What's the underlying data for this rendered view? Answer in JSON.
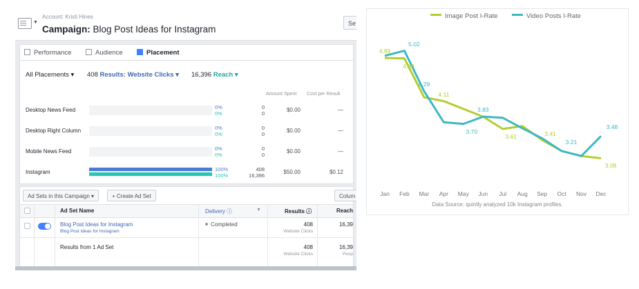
{
  "header": {
    "account": "Account: Kristi Hines",
    "campaign_prefix": "Campaign:",
    "campaign_name": "Blog Post Ideas for Instagram",
    "right_button": "Se"
  },
  "tabs": [
    {
      "label": "Performance",
      "icon": "performance-icon"
    },
    {
      "label": "Audience",
      "icon": "audience-icon"
    },
    {
      "label": "Placement",
      "icon": "placement-icon",
      "active": true
    }
  ],
  "filters": {
    "placements": "All Placements ▾",
    "results_count": "408",
    "results_label": "Results: Website Clicks ▾",
    "reach_count": "16,396",
    "reach_label": "Reach ▾"
  },
  "placement_columns": {
    "amount_spent": "Amount Spent",
    "cost_per_result": "Cost per Result"
  },
  "placement_rows": [
    {
      "name": "Desktop News Feed",
      "pct_results": "0%",
      "pct_reach": "0%",
      "results": "0",
      "reach": "0",
      "amount": "$0.00",
      "cpr": "—",
      "share": 0
    },
    {
      "name": "Desktop Right Column",
      "pct_results": "0%",
      "pct_reach": "0%",
      "results": "0",
      "reach": "0",
      "amount": "$0.00",
      "cpr": "—",
      "share": 0
    },
    {
      "name": "Mobile News Feed",
      "pct_results": "0%",
      "pct_reach": "0%",
      "results": "0",
      "reach": "0",
      "amount": "$0.00",
      "cpr": "—",
      "share": 0
    },
    {
      "name": "Instagram",
      "pct_results": "100%",
      "pct_reach": "100%",
      "results": "408",
      "reach": "16,396",
      "amount": "$50.00",
      "cpr": "$0.12",
      "share": 1
    }
  ],
  "adsets": {
    "dropdown": "Ad Sets in this Campaign ▾",
    "create": "+ Create Ad Set",
    "columns_btn": "Colum",
    "headers": {
      "name": "Ad Set Name",
      "delivery": "Delivery ⓘ",
      "results": "Results ⓘ",
      "reach": "Reach"
    },
    "row": {
      "name": "Blog Post Ideas for Instagram",
      "sub": "Blog Post Ideas for Instagram",
      "delivery": "Completed",
      "results": "408",
      "results_sub": "Website Clicks",
      "reach": "16,39"
    },
    "summary": {
      "label": "Results from 1 Ad Set",
      "results": "408",
      "results_sub": "Website Clicks",
      "reach": "16,39",
      "reach_sub": "Peop"
    }
  },
  "chart_data": {
    "type": "line",
    "categories": [
      "Jan",
      "Feb",
      "Mar",
      "Apr",
      "May",
      "Jun",
      "Jul",
      "Aug",
      "Sep",
      "Oct",
      "Nov",
      "Dec"
    ],
    "series": [
      {
        "name": "Image Post I-Rate",
        "color": "#b5cc2e",
        "values": [
          4.89,
          4.88,
          4.18,
          4.11,
          3.97,
          3.83,
          3.61,
          3.66,
          3.41,
          3.21,
          3.12,
          3.08
        ],
        "labels": {
          "0": "4.89",
          "1": "4.88",
          "3": "4.11",
          "6": "3.61",
          "8": "3.41",
          "11": "3.08"
        }
      },
      {
        "name": "Video Posts I-Rate",
        "color": "#3db8c4",
        "values": [
          4.93,
          5.02,
          4.29,
          3.73,
          3.7,
          3.83,
          3.81,
          3.62,
          3.44,
          3.21,
          3.12,
          3.48
        ],
        "labels": {
          "1": "5.02",
          "2": "4.29",
          "4": "3.70",
          "5": "3.83",
          "9": "3.21",
          "11": "3.48"
        }
      }
    ],
    "ylim": [
      2.6,
      5.4
    ],
    "grid": false,
    "legend": "top-center",
    "source": "Data Source: quintly analyzed 10k Instagram profiles."
  }
}
